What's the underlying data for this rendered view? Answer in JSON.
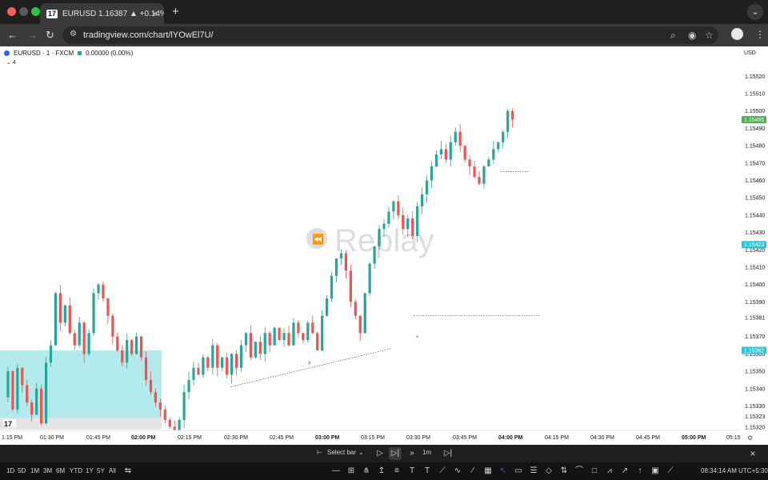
{
  "browser": {
    "tab_title": "EURUSD 1.16387 ▲ +0.14% 1",
    "tab_logo": "17",
    "url": "tradingview.com/chart/lYOwEl7U/"
  },
  "chart_header": {
    "symbol": "EURUSD · 1 · FXCM",
    "change": "0.00000 (0.00%)",
    "indicators_toggle": "⌄ 4",
    "currency": "USD"
  },
  "watermark": "Replay",
  "colors": {
    "up": "#26a69a",
    "down": "#ef5350",
    "zone": "#a6e6e8",
    "price_badge_green": "#4caf50",
    "price_badge_teal": "#26c6da"
  },
  "chart_data": {
    "type": "candlestick",
    "symbol": "EURUSD",
    "ylim": [
      1.15315,
      1.15528
    ],
    "y_ticks": [
      "1.15520",
      "1.15510",
      "1.15500",
      "1.15490",
      "1.15480",
      "1.15470",
      "1.15460",
      "1.15450",
      "1.15440",
      "1.15430",
      "1.15420",
      "1.15410",
      "1.15400",
      "1.15390",
      "1.15381",
      "1.15370",
      "1.15360",
      "1.15350",
      "1.15340",
      "1.15330",
      "1.15323",
      "1.15320"
    ],
    "x_ticks": [
      {
        "label": "1:15 PM",
        "bold": false
      },
      {
        "label": "01:30 PM",
        "bold": false
      },
      {
        "label": "01:45 PM",
        "bold": false
      },
      {
        "label": "02:00 PM",
        "bold": true
      },
      {
        "label": "02:15 PM",
        "bold": false
      },
      {
        "label": "02:30 PM",
        "bold": false
      },
      {
        "label": "02:45 PM",
        "bold": false
      },
      {
        "label": "03:00 PM",
        "bold": true
      },
      {
        "label": "03:15 PM",
        "bold": false
      },
      {
        "label": "03:30 PM",
        "bold": false
      },
      {
        "label": "03:45 PM",
        "bold": false
      },
      {
        "label": "04:00 PM",
        "bold": true
      },
      {
        "label": "04:15 PM",
        "bold": false
      },
      {
        "label": "04:30 PM",
        "bold": false
      },
      {
        "label": "04:45 PM",
        "bold": false
      },
      {
        "label": "05:00 PM",
        "bold": true
      },
      {
        "label": "05:15",
        "bold": false
      }
    ],
    "price_labels": [
      {
        "value": "1.15495",
        "color": "green"
      },
      {
        "value": "1.15423",
        "color": "teal"
      },
      {
        "value": "1.15362",
        "color": "teal"
      }
    ],
    "marker_label": "x",
    "path": [
      1.15335,
      1.1535,
      1.15328,
      1.15352,
      1.15342,
      1.15332,
      1.15325,
      1.1534,
      1.1532,
      1.15355,
      1.15365,
      1.15395,
      1.15378,
      1.15388,
      1.15372,
      1.15365,
      1.15378,
      1.1536,
      1.15372,
      1.15395,
      1.154,
      1.15392,
      1.15382,
      1.1537,
      1.15362,
      1.15355,
      1.15368,
      1.1536,
      1.1537,
      1.15358,
      1.15345,
      1.15338,
      1.15332,
      1.15328,
      1.15322,
      1.15318,
      1.15312,
      1.15322,
      1.15338,
      1.15345,
      1.15352,
      1.15348,
      1.15358,
      1.15352,
      1.15365,
      1.15352,
      1.15358,
      1.15348,
      1.1536,
      1.15352,
      1.15365,
      1.15372,
      1.15358,
      1.15367,
      1.1536,
      1.15372,
      1.15365,
      1.15375,
      1.15368,
      1.15372,
      1.15365,
      1.15378,
      1.15372,
      1.15368,
      1.15378,
      1.15372,
      1.15362,
      1.15382,
      1.15392,
      1.15405,
      1.15415,
      1.15418,
      1.15408,
      1.1539,
      1.15382,
      1.15372,
      1.15395,
      1.15412,
      1.15422,
      1.15432,
      1.15435,
      1.15442,
      1.15448,
      1.1544,
      1.15432,
      1.15438,
      1.15428,
      1.15445,
      1.15452,
      1.1546,
      1.15468,
      1.15475,
      1.15478,
      1.15472,
      1.15482,
      1.15488,
      1.1548,
      1.15472,
      1.15468,
      1.15462,
      1.15458,
      1.15468,
      1.15472,
      1.15478,
      1.15482,
      1.15488,
      1.155,
      1.15495
    ]
  },
  "replay_bar": {
    "select_bar": "Select bar",
    "interval": "1m"
  },
  "timeframes": [
    "1D",
    "5D",
    "1M",
    "3M",
    "6M",
    "YTD",
    "1Y",
    "5Y",
    "All"
  ],
  "clock": "08:34:14 AM UTC+5:30"
}
